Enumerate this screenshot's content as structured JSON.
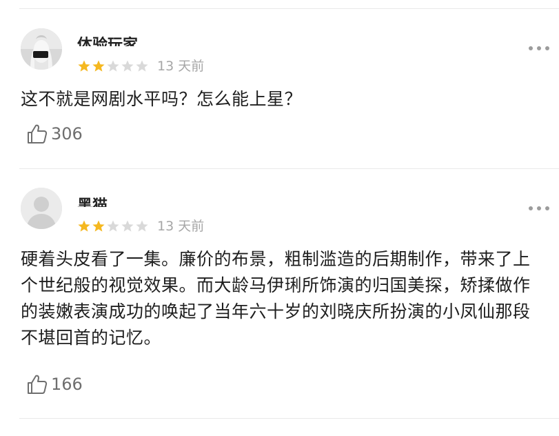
{
  "reviews": [
    {
      "username": "体验玩家",
      "rating_out_of_5": 2,
      "time": "13 天前",
      "text": "这不就是网剧水平吗？怎么能上星？",
      "likes": "306",
      "avatar": "white-bust-sculpture"
    },
    {
      "username": "黑猫",
      "rating_out_of_5": 2,
      "time": "13 天前",
      "text": "硬着头皮看了一集。廉价的布景，粗制滥造的后期制作，带来了上个世纪般的视觉效果。而大龄马伊琍所饰演的归国美探，矫揉做作的装嫩表演成功的唤起了当年六十岁的刘晓庆所扮演的小凤仙那段不堪回首的记忆。",
      "likes": "166",
      "avatar": "default-person"
    }
  ],
  "colors": {
    "star_filled": "#f5b820",
    "star_empty": "#d9d9d9",
    "meta_gray": "#a6a6a6",
    "divider": "#e9e9e9"
  },
  "icons": {
    "more": "ellipsis-icon",
    "like": "thumbs-up-icon",
    "star": "star-icon"
  }
}
